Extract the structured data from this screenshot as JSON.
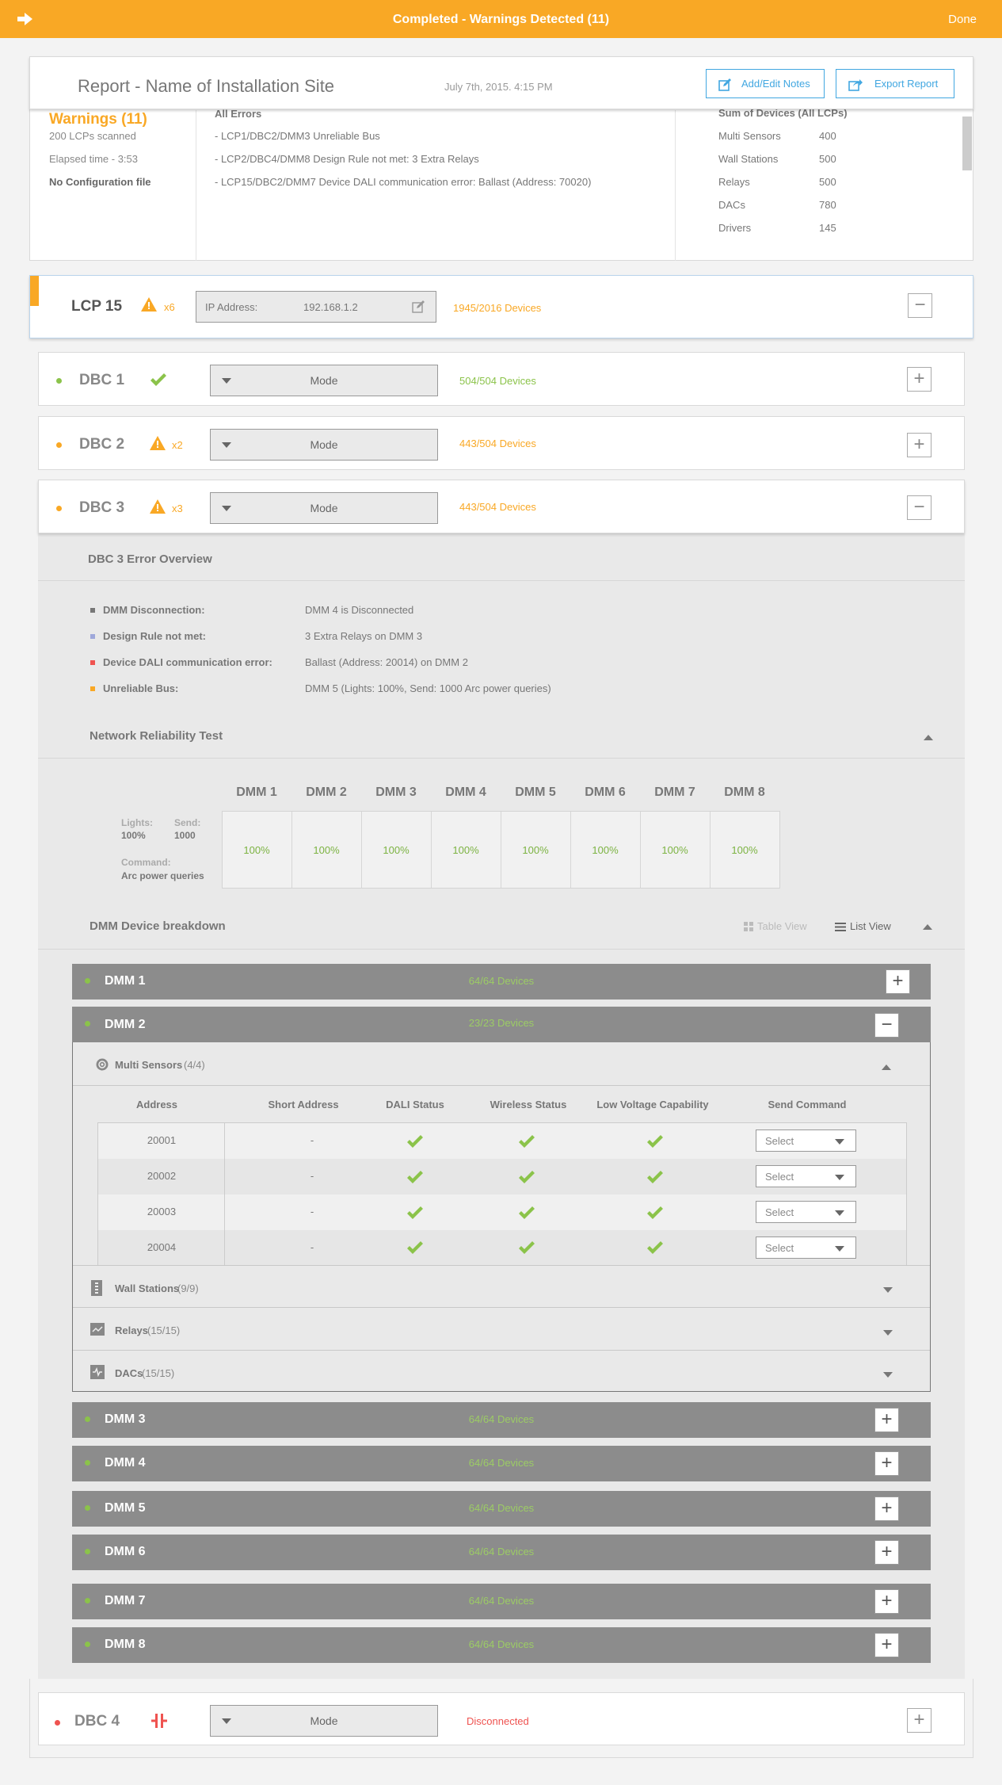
{
  "topbar": {
    "title": "Completed - Warnings Detected (11)",
    "done": "Done"
  },
  "report": {
    "title": "Report - Name of Installation Site",
    "date": "July 7th, 2015. 4:15 PM",
    "notes_btn": "Add/Edit Notes",
    "export_btn": "Export Report",
    "warnings": "Warnings (11)",
    "scanned": "200 LCPs scanned",
    "elapsed": "Elapsed time -  3:53",
    "config": "No Configuration file",
    "errors_title": "All Errors",
    "errors": [
      "- LCP1/DBC2/DMM3 Unreliable Bus",
      "- LCP2/DBC4/DMM8 Design Rule not met: 3 Extra Relays",
      "- LCP15/DBC2/DMM7 Device DALI communication error: Ballast (Address: 70020)"
    ],
    "sum_title": "Sum of Devices (All LCPs)",
    "sums": [
      {
        "k": "Multi Sensors",
        "v": "400"
      },
      {
        "k": "Wall Stations",
        "v": "500"
      },
      {
        "k": "Relays",
        "v": "500"
      },
      {
        "k": "DACs",
        "v": "780"
      },
      {
        "k": "Drivers",
        "v": "145"
      }
    ]
  },
  "lcp": {
    "name": "LCP 15",
    "warn": "x6",
    "ip_label": "IP Address:",
    "ip": "192.168.1.2",
    "devices": "1945/2016 Devices"
  },
  "dbcs": [
    {
      "name": "DBC 1",
      "mode": "Mode",
      "devices": "504/504 Devices"
    },
    {
      "name": "DBC 2",
      "warn": "x2",
      "mode": "Mode",
      "devices": "443/504 Devices"
    },
    {
      "name": "DBC 3",
      "warn": "x3",
      "mode": "Mode",
      "devices": "443/504 Devices"
    },
    {
      "name": "DBC 4",
      "mode": "Mode",
      "devices": "Disconnected"
    }
  ],
  "overview": {
    "title": "DBC 3 Error Overview",
    "items": [
      {
        "k": "DMM Disconnection:",
        "v": "DMM 4 is Disconnected",
        "c": "#777"
      },
      {
        "k": "Design Rule not met:",
        "v": "3 Extra Relays on DMM 3",
        "c": "#9fa8da"
      },
      {
        "k": "Device DALI communication error:",
        "v": "Ballast (Address: 20014) on DMM 2",
        "c": "#ef5350"
      },
      {
        "k": "Unreliable Bus:",
        "v": "DMM 5 (Lights: 100%, Send: 1000 Arc power queries)",
        "c": "#f9a825"
      }
    ]
  },
  "nrt": {
    "title": "Network Reliability Test",
    "lights_label": "Lights:",
    "lights": "100%",
    "send_label": "Send:",
    "send": "1000",
    "cmd_label": "Command:",
    "cmd": "Arc power queries",
    "cols": [
      "DMM 1",
      "DMM 2",
      "DMM 3",
      "DMM 4",
      "DMM 5",
      "DMM 6",
      "DMM 7",
      "DMM 8"
    ],
    "vals": [
      "100%",
      "100%",
      "100%",
      "100%",
      "100%",
      "100%",
      "100%",
      "100%"
    ]
  },
  "breakdown": {
    "title": "DMM Device breakdown",
    "table_view": "Table View",
    "list_view": "List View"
  },
  "dmms": [
    {
      "name": "DMM 1",
      "devices": "64/64 Devices"
    },
    {
      "name": "DMM 2",
      "devices": "23/23 Devices"
    },
    {
      "name": "DMM 3",
      "devices": "64/64 Devices"
    },
    {
      "name": "DMM 4",
      "devices": "64/64 Devices"
    },
    {
      "name": "DMM 5",
      "devices": "64/64 Devices"
    },
    {
      "name": "DMM 6",
      "devices": "64/64 Devices"
    },
    {
      "name": "DMM 7",
      "devices": "64/64 Devices"
    },
    {
      "name": "DMM 8",
      "devices": "64/64 Devices"
    }
  ],
  "sensors": {
    "title": "Multi Sensors",
    "count": "(4/4)",
    "headers": [
      "Address",
      "Short Address",
      "DALI Status",
      "Wireless Status",
      "Low Voltage Capability",
      "Send Command"
    ],
    "rows": [
      {
        "addr": "20001",
        "short": "-",
        "cmd": "Select"
      },
      {
        "addr": "20002",
        "short": "-",
        "cmd": "Select"
      },
      {
        "addr": "20003",
        "short": "-",
        "cmd": "Select"
      },
      {
        "addr": "20004",
        "short": "-",
        "cmd": "Select"
      }
    ]
  },
  "groups": [
    {
      "title": "Wall Stations",
      "count": "(9/9)"
    },
    {
      "title": "Relays",
      "count": "(15/15)"
    },
    {
      "title": "DACs",
      "count": "(15/15)"
    }
  ],
  "colors": {
    "accent": "#f9a825",
    "blue": "#41a7e1",
    "green": "#8bc34a",
    "red": "#ef5350"
  }
}
